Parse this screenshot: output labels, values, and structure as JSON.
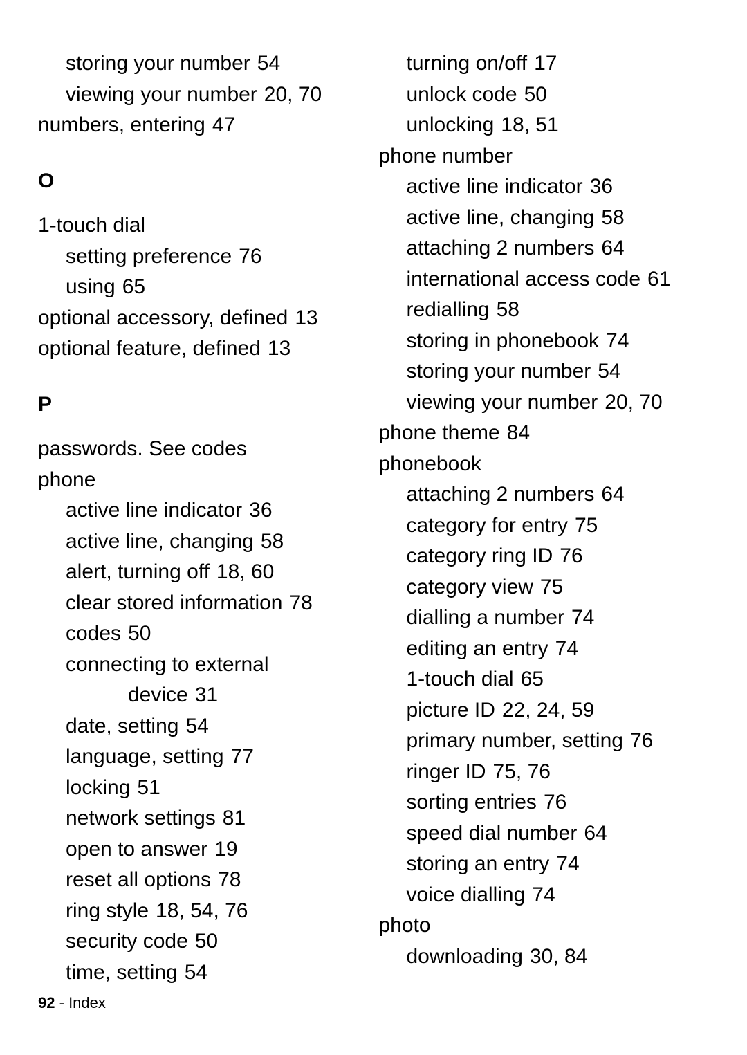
{
  "footer": {
    "page_number": "92",
    "section": "Index"
  },
  "left": {
    "pre": [
      {
        "label": "storing your number",
        "pages": "54",
        "lvl": 1
      },
      {
        "label": "viewing your number",
        "pages": "20, 70",
        "lvl": 1
      },
      {
        "label": "numbers, entering",
        "pages": "47",
        "lvl": 0
      }
    ],
    "O": {
      "heading": "O",
      "items": [
        {
          "label": "1-touch dial",
          "pages": "",
          "lvl": 0
        },
        {
          "label": "setting preference",
          "pages": "76",
          "lvl": 1
        },
        {
          "label": "using",
          "pages": "65",
          "lvl": 1
        },
        {
          "label": "optional accessory, defined",
          "pages": "13",
          "lvl": 0
        },
        {
          "label": "optional feature, defined",
          "pages": "13",
          "lvl": 0
        }
      ]
    },
    "P": {
      "heading": "P",
      "items": [
        {
          "label": "passwords. ",
          "see": "See",
          "see2": " codes",
          "lvl": 0
        },
        {
          "label": "phone",
          "pages": "",
          "lvl": 0
        },
        {
          "label": "active line indicator",
          "pages": "36",
          "lvl": 1
        },
        {
          "label": "active line, changing",
          "pages": "58",
          "lvl": 1
        },
        {
          "label": "alert, turning off",
          "pages": "18, 60",
          "lvl": 1
        },
        {
          "label": "clear stored information",
          "pages": "78",
          "lvl": 1
        },
        {
          "label": "codes",
          "pages": "50",
          "lvl": 1
        },
        {
          "label": "connecting to external",
          "pages": "",
          "lvl": 1
        },
        {
          "label": "device",
          "pages": "31",
          "lvl": 2
        },
        {
          "label": "date, setting",
          "pages": "54",
          "lvl": 1
        },
        {
          "label": "language, setting",
          "pages": "77",
          "lvl": 1
        },
        {
          "label": "locking",
          "pages": "51",
          "lvl": 1
        },
        {
          "label": "network settings",
          "pages": "81",
          "lvl": 1
        },
        {
          "label": "open to answer",
          "pages": "19",
          "lvl": 1
        },
        {
          "label": "reset all options",
          "pages": "78",
          "lvl": 1
        },
        {
          "label": "ring style",
          "pages": "18, 54, 76",
          "lvl": 1
        },
        {
          "label": "security code",
          "pages": "50",
          "lvl": 1
        },
        {
          "label": "time, setting",
          "pages": "54",
          "lvl": 1
        }
      ]
    }
  },
  "right": {
    "items": [
      {
        "label": "turning on/off",
        "pages": "17",
        "lvl": 1
      },
      {
        "label": "unlock code",
        "pages": "50",
        "lvl": 1
      },
      {
        "label": "unlocking",
        "pages": "18, 51",
        "lvl": 1
      },
      {
        "label": "phone number",
        "pages": "",
        "lvl": 0
      },
      {
        "label": "active line indicator",
        "pages": "36",
        "lvl": 1
      },
      {
        "label": "active line, changing",
        "pages": "58",
        "lvl": 1
      },
      {
        "label": "attaching 2 numbers",
        "pages": "64",
        "lvl": 1
      },
      {
        "label": "international access code",
        "pages": "61",
        "lvl": 1
      },
      {
        "label": "redialling",
        "pages": "58",
        "lvl": 1
      },
      {
        "label": "storing in phonebook",
        "pages": "74",
        "lvl": 1
      },
      {
        "label": "storing your number",
        "pages": "54",
        "lvl": 1
      },
      {
        "label": "viewing your number",
        "pages": "20, 70",
        "lvl": 1
      },
      {
        "label": "phone theme",
        "pages": "84",
        "lvl": 0
      },
      {
        "label": "phonebook",
        "pages": "",
        "lvl": 0
      },
      {
        "label": "attaching 2 numbers",
        "pages": "64",
        "lvl": 1
      },
      {
        "label": "category for entry",
        "pages": "75",
        "lvl": 1
      },
      {
        "label": "category ring ID",
        "pages": "76",
        "lvl": 1
      },
      {
        "label": "category view",
        "pages": "75",
        "lvl": 1
      },
      {
        "label": "dialling a number",
        "pages": "74",
        "lvl": 1
      },
      {
        "label": "editing an entry",
        "pages": "74",
        "lvl": 1
      },
      {
        "label": "1-touch dial",
        "pages": "65",
        "lvl": 1
      },
      {
        "label": "picture ID",
        "pages": "22, 24, 59",
        "lvl": 1
      },
      {
        "label": "primary number, setting",
        "pages": "76",
        "lvl": 1
      },
      {
        "label": "ringer ID",
        "pages": "75, 76",
        "lvl": 1
      },
      {
        "label": "sorting entries",
        "pages": "76",
        "lvl": 1
      },
      {
        "label": "speed dial number",
        "pages": "64",
        "lvl": 1
      },
      {
        "label": "storing an entry",
        "pages": "74",
        "lvl": 1
      },
      {
        "label": "voice dialling",
        "pages": "74",
        "lvl": 1
      },
      {
        "label": "photo",
        "pages": "",
        "lvl": 0
      },
      {
        "label": "downloading",
        "pages": "30, 84",
        "lvl": 1
      }
    ]
  }
}
